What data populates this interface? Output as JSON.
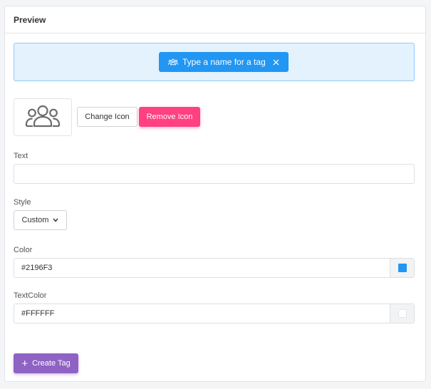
{
  "card": {
    "title": "Preview"
  },
  "preview": {
    "tag_text": "Type a name for a tag",
    "tag_icon": "users-group-icon",
    "close_icon": "close-icon"
  },
  "icon_section": {
    "icon": "users-group-icon",
    "change_label": "Change Icon",
    "remove_label": "Remove Icon"
  },
  "fields": {
    "text": {
      "label": "Text",
      "value": "",
      "placeholder": ""
    },
    "style": {
      "label": "Style",
      "selected": "Custom"
    },
    "color": {
      "label": "Color",
      "value": "#2196F3"
    },
    "text_color": {
      "label": "TextColor",
      "value": "#FFFFFF"
    }
  },
  "actions": {
    "create_label": "Create Tag"
  },
  "colors": {
    "tag_bg": "#2196F3",
    "tag_text": "#FFFFFF",
    "remove_button": "#FF4081",
    "create_button": "#8E63C4",
    "preview_bg": "#E3F2FD"
  }
}
